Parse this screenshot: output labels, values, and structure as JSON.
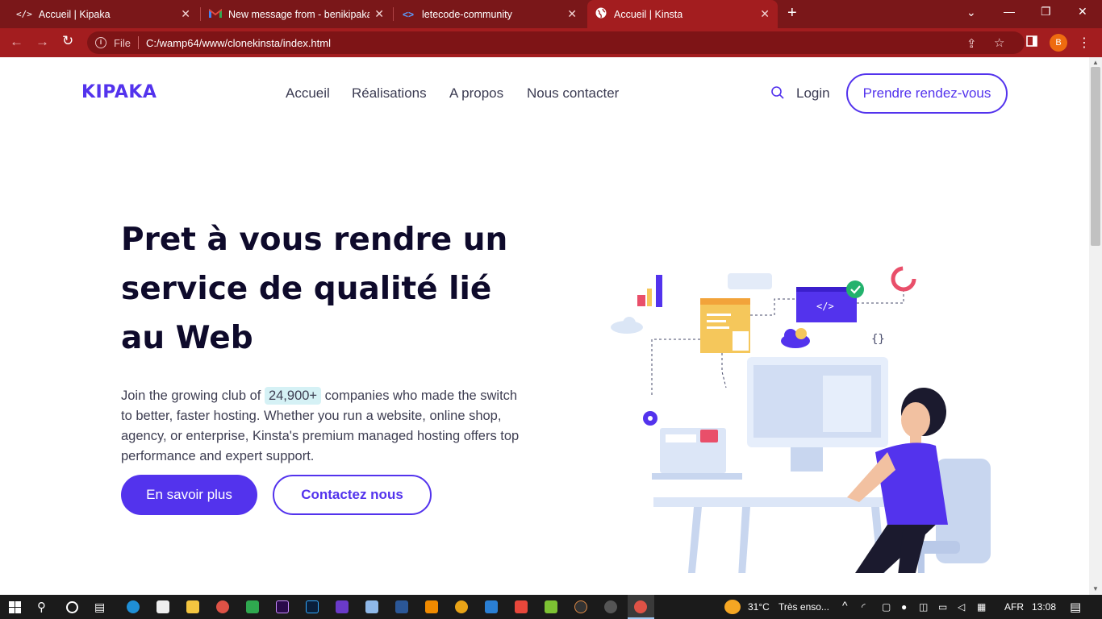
{
  "browser": {
    "tabs": [
      {
        "title": "Accueil | Kipaka",
        "icon": "code-icon"
      },
      {
        "title": "New message from - benikipaka@",
        "icon": "gmail-icon"
      },
      {
        "title": "letecode-community",
        "icon": "code-icon"
      },
      {
        "title": "Accueil | Kinsta",
        "icon": "globe-icon"
      }
    ],
    "file_label": "File",
    "url": "C:/wamp64/www/clonekinsta/index.html",
    "profile_initial": "B"
  },
  "site": {
    "logo": "KIPAKA",
    "nav": [
      "Accueil",
      "Réalisations",
      "A propos",
      "Nous contacter"
    ],
    "login": "Login",
    "cta": "Prendre rendez-vous"
  },
  "hero": {
    "title": "Pret à vous rendre un service de qualité lié au Web",
    "text_before": "Join the growing club of ",
    "highlight": "24,900+",
    "text_after": " companies who made the switch to better, faster hosting. Whether you run a website, online shop, agency, or enterprise, Kinsta's premium managed hosting offers top performance and expert support.",
    "primary_button": "En savoir plus",
    "secondary_button": "Contactez nous"
  },
  "taskbar": {
    "weather": "31°C",
    "weather_text": "Très enso...",
    "language": "AFR",
    "time": "13:08"
  },
  "colors": {
    "brand": "#5333ed",
    "chrome": "#a31d1f",
    "tabbar": "#7a1719",
    "heading": "#0e0a2b"
  }
}
